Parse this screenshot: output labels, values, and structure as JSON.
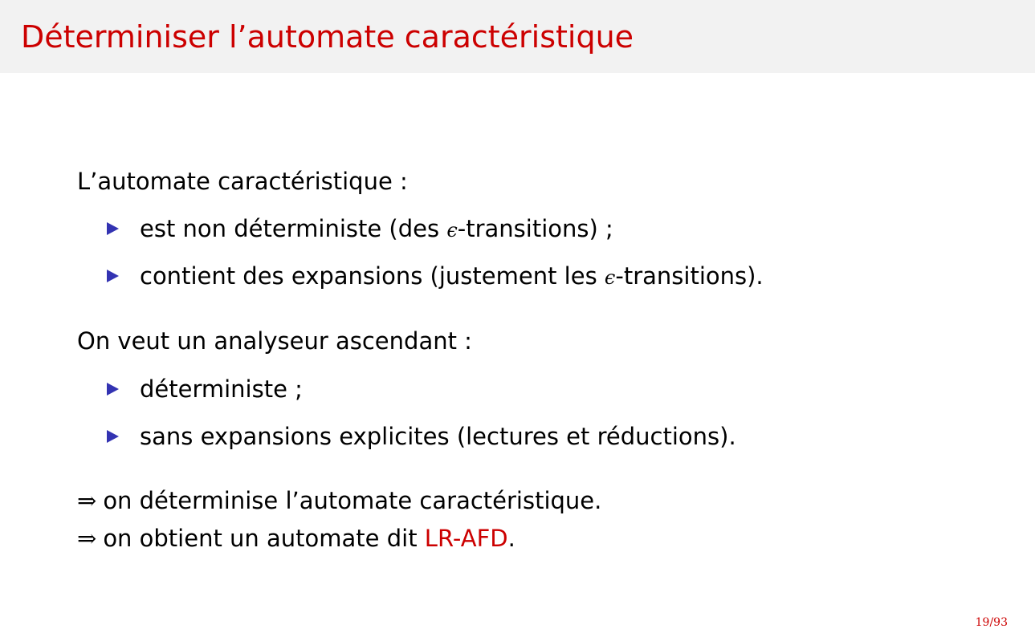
{
  "slide": {
    "title": "Déterminiser l’automate caractéristique",
    "page": "19/93"
  },
  "section1": {
    "intro": "L’automate caractéristique :",
    "items": [
      {
        "before": "est non déterministe (des ",
        "eps": "ϵ",
        "after": "-transitions) ;"
      },
      {
        "before": "contient des expansions (justement les ",
        "eps": "ϵ",
        "after": "-transitions)."
      }
    ]
  },
  "section2": {
    "intro": "On veut un analyseur ascendant :",
    "items": [
      {
        "text": "déterministe ;"
      },
      {
        "text": "sans expansions explicites (lectures et réductions)."
      }
    ]
  },
  "conclusions": {
    "arrow": "⇒",
    "line1": "on déterminise l’automate caractéristique.",
    "line2_before": "on obtient un automate dit ",
    "line2_highlight": "LR-AFD",
    "line2_after": "."
  },
  "colors": {
    "title": "#cc0000",
    "bullet": "#3333b2",
    "highlight": "#cc0000",
    "titlebar_bg": "#f2f2f2"
  }
}
